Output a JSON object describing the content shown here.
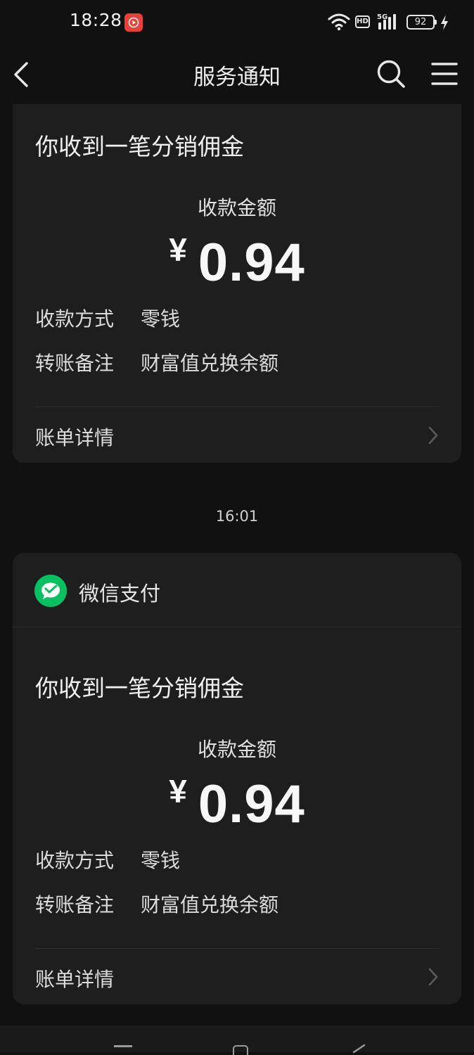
{
  "status_bar": {
    "time": "18:28",
    "hd_label": "HD",
    "network_label": "5G",
    "battery": "92"
  },
  "nav": {
    "title": "服务通知"
  },
  "cards": [
    {
      "notice_title": "你收到一笔分销佣金",
      "amount_label": "收款金额",
      "currency": "¥",
      "amount": "0.94",
      "method_label": "收款方式",
      "method_value": "零钱",
      "remark_label": "转账备注",
      "remark_value": "财富值兑换余额",
      "detail_label": "账单详情"
    },
    {
      "pay_name": "微信支付",
      "notice_title": "你收到一笔分销佣金",
      "amount_label": "收款金额",
      "currency": "¥",
      "amount": "0.94",
      "method_label": "收款方式",
      "method_value": "零钱",
      "remark_label": "转账备注",
      "remark_value": "财富值兑换余额",
      "detail_label": "账单详情"
    }
  ],
  "timestamp": "16:01",
  "colors": {
    "background": "#111111",
    "card": "#1e1e1e",
    "wechat_green": "#07c160"
  }
}
